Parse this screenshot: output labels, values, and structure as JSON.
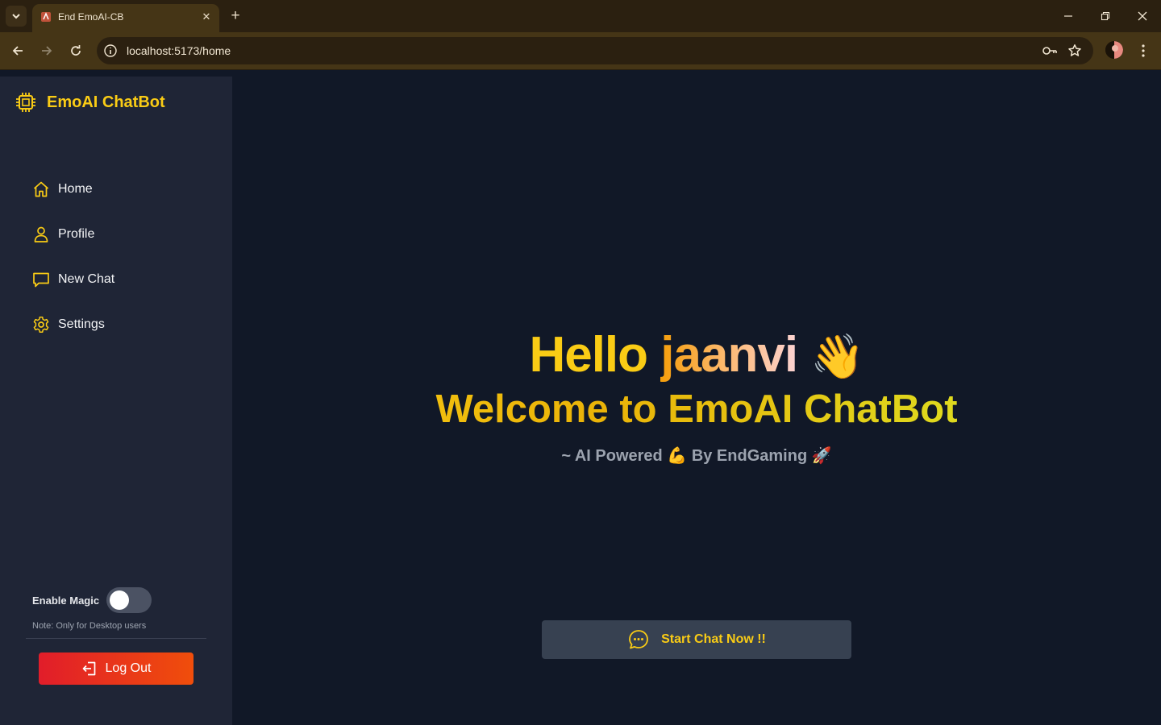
{
  "browser": {
    "tab_title": "End EmoAI-CB",
    "url": "localhost:5173/home"
  },
  "app": {
    "brand": "EmoAI ChatBot",
    "nav": [
      {
        "label": "Home",
        "icon": "home-icon"
      },
      {
        "label": "Profile",
        "icon": "user-icon"
      },
      {
        "label": "New Chat",
        "icon": "chat-bubble-icon"
      },
      {
        "label": "Settings",
        "icon": "gear-icon"
      }
    ],
    "magic": {
      "label": "Enable Magic",
      "enabled": false,
      "note": "Note: Only for Desktop users"
    },
    "logout_label": "Log Out"
  },
  "hero": {
    "greeting": "Hello",
    "username": "jaanvi",
    "wave_emoji": "👋",
    "welcome": "Welcome to EmoAI ChatBot",
    "tagline_part1": "~ AI Powered",
    "muscle_emoji": "💪",
    "tagline_part2": "By EndGaming",
    "rocket_emoji": "🚀",
    "start_label": "Start Chat Now !!"
  },
  "colors": {
    "accent": "#facc15",
    "sidebar_bg": "#1f2536",
    "main_bg": "#111827",
    "logout_start": "#e11d2a",
    "logout_end": "#f04e0b"
  }
}
